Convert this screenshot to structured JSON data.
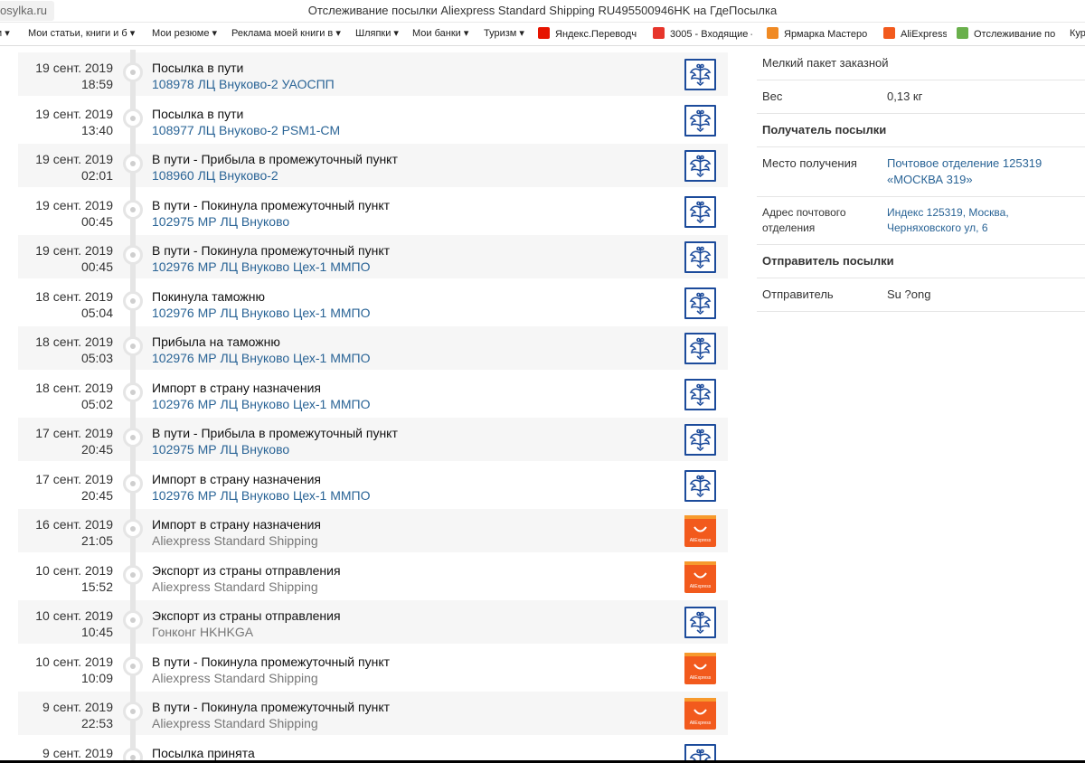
{
  "browser": {
    "url": "osylka.ru",
    "title": "Отслеживание посылки Aliexpress Standard Shipping RU495500946HK на ГдеПосылка"
  },
  "bookmarks": [
    {
      "label": "ги ▾",
      "icon": "none",
      "color": ""
    },
    {
      "label": "Мои статьи, книги и б ▾",
      "icon": "none",
      "color": ""
    },
    {
      "label": "Мои резюме ▾",
      "icon": "none",
      "color": ""
    },
    {
      "label": "Реклама моей книги в ▾",
      "icon": "none",
      "color": ""
    },
    {
      "label": "Шляпки ▾",
      "icon": "none",
      "color": ""
    },
    {
      "label": "Мои банки ▾",
      "icon": "none",
      "color": ""
    },
    {
      "label": "Туризм ▾",
      "icon": "none",
      "color": ""
    },
    {
      "label": "Яндекс.Переводч",
      "icon": "yandex-icon",
      "color": "#e61400"
    },
    {
      "label": "3005 - Входящие –",
      "icon": "mail-icon",
      "color": "#e7352b"
    },
    {
      "label": "Ярмарка Мастеро",
      "icon": "craft-icon",
      "color": "#f08a24"
    },
    {
      "label": "AliExpress",
      "icon": "aliexpress-icon",
      "color": "#f25a1d"
    },
    {
      "label": "Отслеживание по",
      "icon": "tracking-icon",
      "color": "#6ab04c"
    },
    {
      "label": "Кур",
      "icon": "none",
      "color": ""
    }
  ],
  "events": [
    {
      "date": "19 сент. 2019",
      "time": "18:59",
      "status": "Посылка в пути",
      "location": "108978 ЛЦ Внуково-2 УАОСПП",
      "link": true,
      "carrier": "russian-post"
    },
    {
      "date": "19 сент. 2019",
      "time": "13:40",
      "status": "Посылка в пути",
      "location": "108977 ЛЦ Внуково-2 PSM1-CM",
      "link": true,
      "carrier": "russian-post"
    },
    {
      "date": "19 сент. 2019",
      "time": "02:01",
      "status": "В пути - Прибыла в промежуточный пункт",
      "location": "108960 ЛЦ Внуково-2",
      "link": true,
      "carrier": "russian-post"
    },
    {
      "date": "19 сент. 2019",
      "time": "00:45",
      "status": "В пути - Покинула промежуточный пункт",
      "location": "102975 МР ЛЦ Внуково",
      "link": true,
      "carrier": "russian-post"
    },
    {
      "date": "19 сент. 2019",
      "time": "00:45",
      "status": "В пути - Покинула промежуточный пункт",
      "location": "102976 МР ЛЦ Внуково Цех-1 ММПО",
      "link": true,
      "carrier": "russian-post"
    },
    {
      "date": "18 сент. 2019",
      "time": "05:04",
      "status": "Покинула таможню",
      "location": "102976 МР ЛЦ Внуково Цех-1 ММПО",
      "link": true,
      "carrier": "russian-post"
    },
    {
      "date": "18 сент. 2019",
      "time": "05:03",
      "status": "Прибыла на таможню",
      "location": "102976 МР ЛЦ Внуково Цех-1 ММПО",
      "link": true,
      "carrier": "russian-post"
    },
    {
      "date": "18 сент. 2019",
      "time": "05:02",
      "status": "Импорт в страну назначения",
      "location": "102976 МР ЛЦ Внуково Цех-1 ММПО",
      "link": true,
      "carrier": "russian-post"
    },
    {
      "date": "17 сент. 2019",
      "time": "20:45",
      "status": "В пути - Прибыла в промежуточный пункт",
      "location": "102975 МР ЛЦ Внуково",
      "link": true,
      "carrier": "russian-post"
    },
    {
      "date": "17 сент. 2019",
      "time": "20:45",
      "status": "Импорт в страну назначения",
      "location": "102976 МР ЛЦ Внуково Цех-1 ММПО",
      "link": true,
      "carrier": "russian-post"
    },
    {
      "date": "16 сент. 2019",
      "time": "21:05",
      "status": "Импорт в страну назначения",
      "location": "Aliexpress Standard Shipping",
      "link": false,
      "carrier": "aliexpress"
    },
    {
      "date": "10 сент. 2019",
      "time": "15:52",
      "status": "Экспорт из страны отправления",
      "location": "Aliexpress Standard Shipping",
      "link": false,
      "carrier": "aliexpress"
    },
    {
      "date": "10 сент. 2019",
      "time": "10:45",
      "status": "Экспорт из страны отправления",
      "location": "Гонконг HKHKGA",
      "link": false,
      "carrier": "russian-post"
    },
    {
      "date": "10 сент. 2019",
      "time": "10:09",
      "status": "В пути - Покинула промежуточный пункт",
      "location": "Aliexpress Standard Shipping",
      "link": false,
      "carrier": "aliexpress"
    },
    {
      "date": "9 сент. 2019",
      "time": "22:53",
      "status": "В пути - Покинула промежуточный пункт",
      "location": "Aliexpress Standard Shipping",
      "link": false,
      "carrier": "aliexpress"
    },
    {
      "date": "9 сент. 2019",
      "time": "",
      "status": "Посылка принята",
      "location": "",
      "link": false,
      "carrier": "russian-post"
    }
  ],
  "side": {
    "package_type": "Мелкий пакет заказной",
    "weight_label": "Вес",
    "weight_value": "0,13 кг",
    "recipient_header": "Получатель посылки",
    "pickup_label": "Место получения",
    "pickup_value": "Почтовое отделение 125319 «МОСКВА 319»",
    "address_label": "Адрес почтового отделения",
    "address_value": "Индекс 125319, Москва, Черняховского ул, 6",
    "sender_header": "Отправитель посылки",
    "sender_label": "Отправитель",
    "sender_value": "Su ?ong"
  },
  "colors": {
    "russian_post": "#1c4b9b",
    "aliexpress": "#f25a1d",
    "link": "#2a6496"
  }
}
